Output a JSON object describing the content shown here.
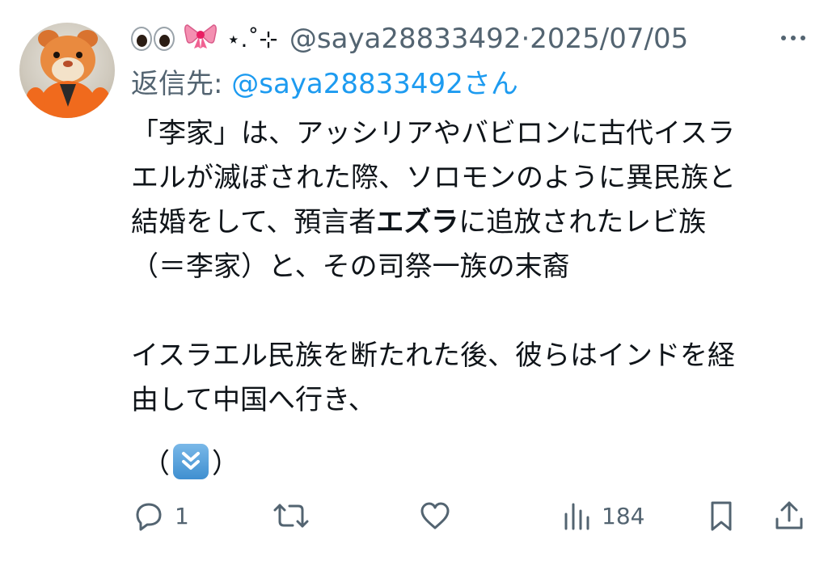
{
  "tweet": {
    "header": {
      "sparkle": "⋆.˚⊹",
      "handle": "@saya28833492",
      "separator": "·",
      "date": "2025/07/05"
    },
    "reply": {
      "prefix": "返信先: ",
      "mention": "@saya28833492",
      "suffix": "さん"
    },
    "body": {
      "p1_line1": "「李家」は、アッシリアやバビロンに古代イスラ",
      "p1_line2": "エルが滅ぼされた際、ソロモンのように異民族と",
      "p1_line3_a": "結婚をして、預言者",
      "p1_line3_bold": "エズラ",
      "p1_line3_b": "に追放されたレビ族",
      "p1_line4": "（＝李家）と、その司祭一族の末裔",
      "p2_line1": "イスラエル民族を断たれた後、彼らはインドを経",
      "p2_line2": "由して中国へ行き、",
      "p3_open": "（",
      "p3_close": "）"
    },
    "actions": {
      "reply_count": "1",
      "views_count": "184"
    }
  }
}
